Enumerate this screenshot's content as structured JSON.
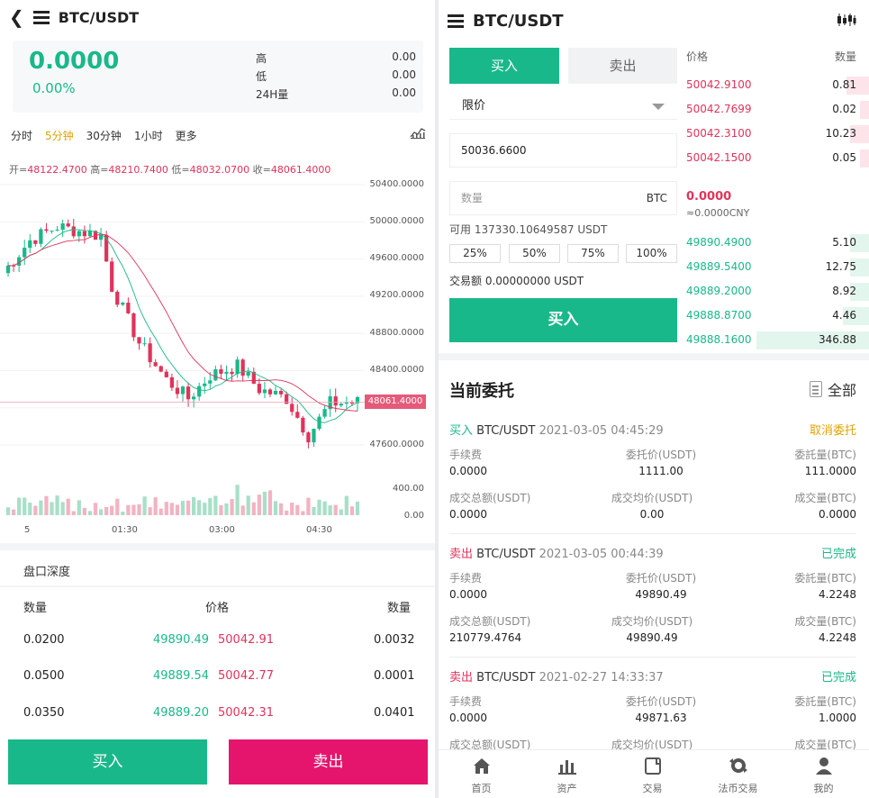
{
  "left": {
    "header": {
      "title": "BTC/USDT"
    },
    "price": {
      "last": "0.0000",
      "change": "0.00%"
    },
    "stats": [
      {
        "label": "高",
        "value": "0.00"
      },
      {
        "label": "低",
        "value": "0.00"
      },
      {
        "label": "24H量",
        "value": "0.00"
      }
    ],
    "periods": [
      "分时",
      "5分钟",
      "30分钟",
      "1小时",
      "更多"
    ],
    "active_period": "5分钟",
    "ohlc": {
      "open_label": "开=",
      "open": "48122.4700",
      "high_label": "高=",
      "high": "48210.7400",
      "low_label": "低=",
      "low": "48032.0700",
      "close_label": "收=",
      "close": "48061.4000"
    },
    "current_price_tag": "48061.4000",
    "depth": {
      "title": "盘口深度",
      "headers": [
        "数量",
        "价格",
        "数量"
      ],
      "rows": [
        {
          "buy_qty": "0.0200",
          "buy_price": "49890.49",
          "sell_price": "50042.91",
          "sell_qty": "0.0032"
        },
        {
          "buy_qty": "0.0500",
          "buy_price": "49889.54",
          "sell_price": "50042.77",
          "sell_qty": "0.0001"
        },
        {
          "buy_qty": "0.0350",
          "buy_price": "49889.20",
          "sell_price": "50042.31",
          "sell_qty": "0.0401"
        }
      ]
    },
    "buy_button": "买入",
    "sell_button": "卖出"
  },
  "chart_data": {
    "type": "candlestick",
    "y_ticks": [
      "50400.0000",
      "50000.0000",
      "49600.0000",
      "49200.0000",
      "48800.0000",
      "48400.0000",
      "48000.0000",
      "47600.0000"
    ],
    "volume_ticks": [
      "400.00",
      "0.00"
    ],
    "x_ticks": [
      "5",
      "01:30",
      "03:00",
      "04:30"
    ],
    "ylim": [
      47400,
      50600
    ],
    "colors": {
      "up": "#19b88a",
      "down": "#e0335a",
      "ma1": "#e0335a",
      "ma2": "#19b88a"
    }
  },
  "right": {
    "header": {
      "title": "BTC/USDT"
    },
    "tabs": {
      "buy": "买入",
      "sell": "卖出"
    },
    "order_type": "限价",
    "price_value": "50036.6600",
    "qty_placeholder": "数量",
    "qty_unit": "BTC",
    "available": "可用 137330.10649587 USDT",
    "percents": [
      "25%",
      "50%",
      "75%",
      "100%"
    ],
    "amount": "交易额 0.00000000 USDT",
    "buy_button": "买入",
    "orderbook": {
      "price_header": "价格",
      "qty_header": "数量",
      "asks": [
        {
          "price": "50042.9100",
          "qty": "0.81",
          "depth": 0.12
        },
        {
          "price": "50042.7699",
          "qty": "0.02",
          "depth": 0.05
        },
        {
          "price": "50042.3100",
          "qty": "10.23",
          "depth": 0.1
        },
        {
          "price": "50042.1500",
          "qty": "0.05",
          "depth": 0.05
        }
      ],
      "mid_price": "0.0000",
      "mid_cny": "≈0.0000CNY",
      "bids": [
        {
          "price": "49890.4900",
          "qty": "5.10",
          "depth": 0.1
        },
        {
          "price": "49889.5400",
          "qty": "12.75",
          "depth": 0.1
        },
        {
          "price": "49889.2000",
          "qty": "8.92",
          "depth": 0.1
        },
        {
          "price": "49888.8700",
          "qty": "4.46",
          "depth": 0.14
        },
        {
          "price": "49888.1600",
          "qty": "346.88",
          "depth": 0.6
        }
      ]
    },
    "current_orders": {
      "title": "当前委托",
      "all_label": "全部",
      "labels": {
        "fee": "手续费",
        "price": "委托价(USDT)",
        "qty": "委託量(BTC)",
        "total": "成交总额(USDT)",
        "avg": "成交均价(USDT)",
        "filled": "成交量(BTC)"
      },
      "orders": [
        {
          "side": "买入",
          "pair": "BTC/USDT",
          "time": "2021-03-05 04:45:29",
          "status": "取消委托",
          "fee": "0.0000",
          "price": "1111.00",
          "qty": "111.0000",
          "total": "0.0000",
          "avg": "0.00",
          "filled": "0.0000"
        },
        {
          "side": "卖出",
          "pair": "BTC/USDT",
          "time": "2021-03-05 00:44:39",
          "status": "已完成",
          "fee": "0.0000",
          "price": "49890.49",
          "qty": "4.2248",
          "total": "210779.4764",
          "avg": "49890.49",
          "filled": "4.2248"
        },
        {
          "side": "卖出",
          "pair": "BTC/USDT",
          "time": "2021-02-27 14:33:37",
          "status": "已完成",
          "fee": "0.0000",
          "price": "49871.63",
          "qty": "1.0000",
          "total": "",
          "avg": "",
          "filled": ""
        }
      ]
    },
    "nav": [
      "首页",
      "资产",
      "交易",
      "法币交易",
      "我的"
    ]
  }
}
